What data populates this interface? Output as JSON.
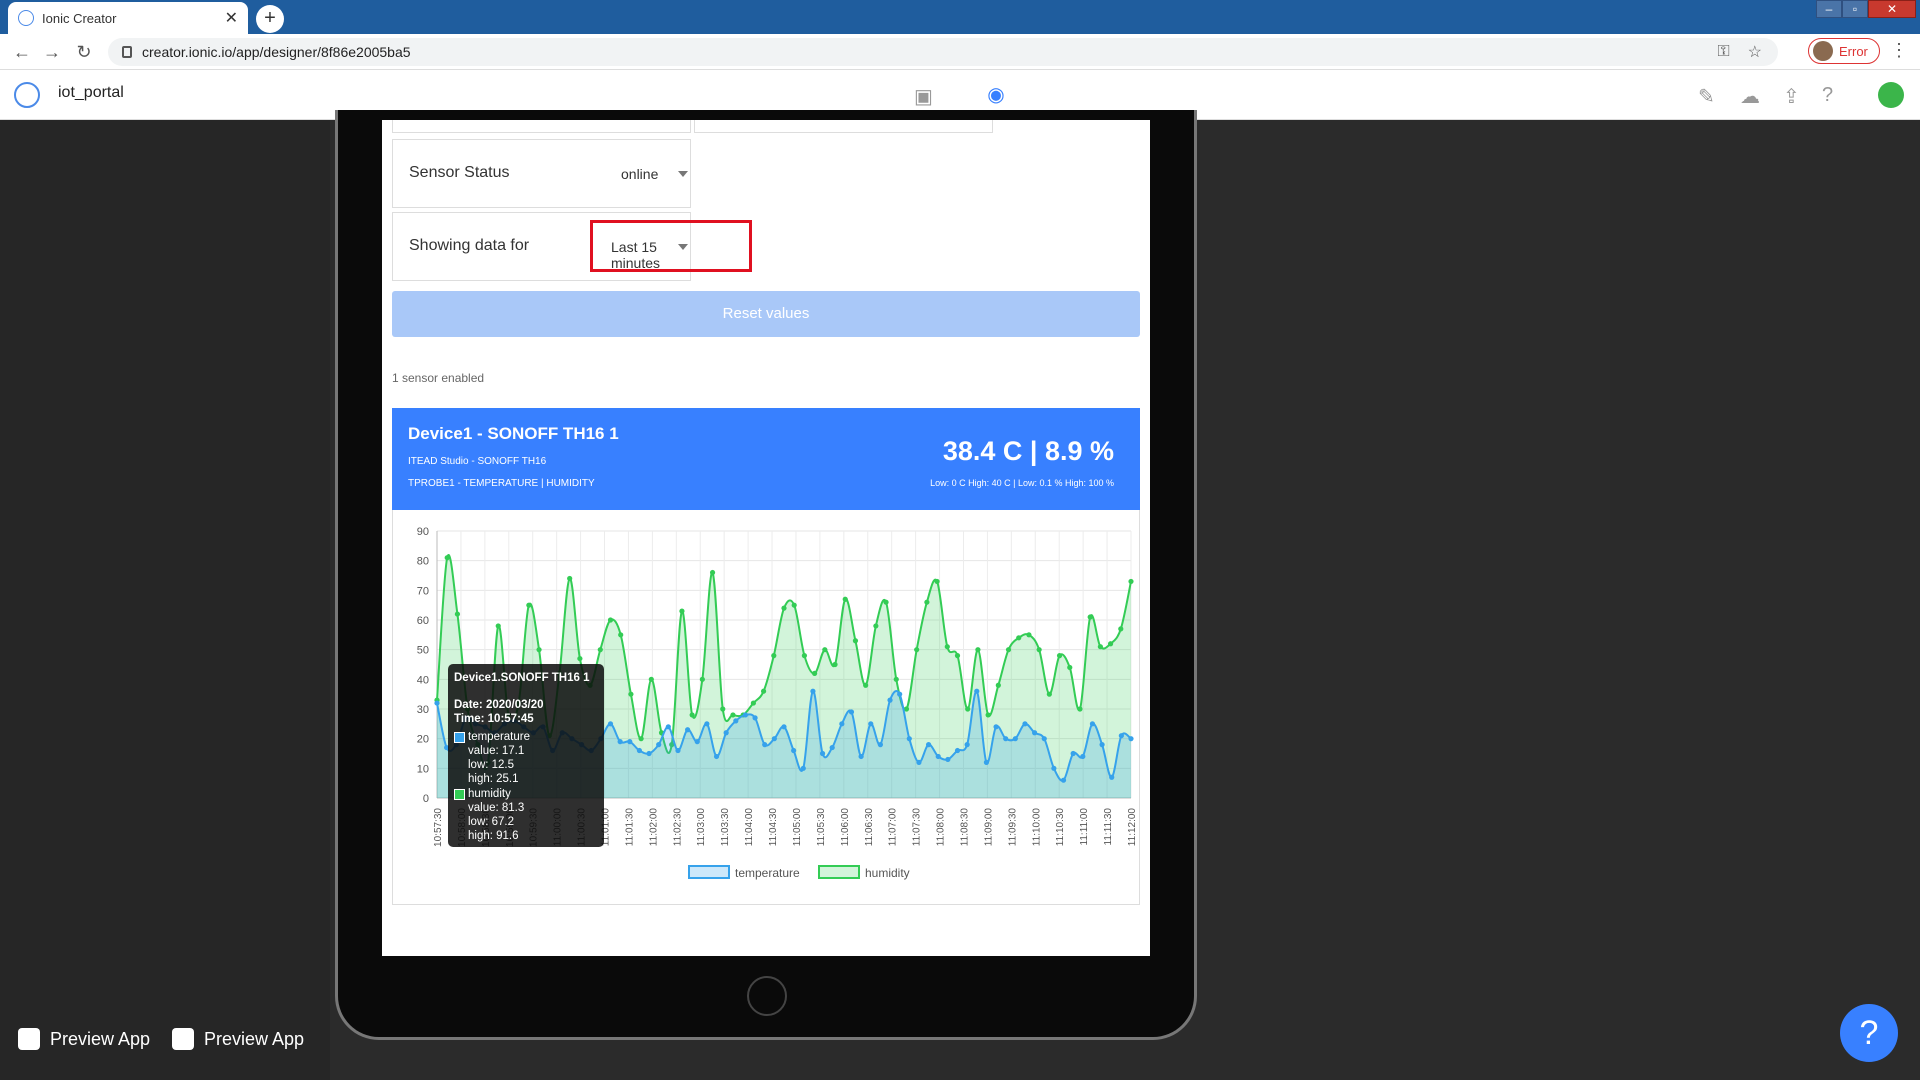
{
  "browser": {
    "tab_title": "Ionic Creator",
    "url": "creator.ionic.io/app/designer/8f86e2005ba5",
    "error_label": "Error"
  },
  "app": {
    "name": "iot_portal"
  },
  "icons": {
    "back": "arrow-left-icon",
    "forward": "arrow-right-icon",
    "reload": "reload-icon",
    "lock": "lock-icon",
    "key": "key-icon",
    "star": "star-icon",
    "menu": "kebab-menu-icon",
    "preview": "eye-icon",
    "design": "device-icon",
    "brush": "brush-icon",
    "download": "cloud-download-icon",
    "share": "share-icon",
    "help": "help-icon",
    "apple": "apple-icon",
    "android": "play-store-icon"
  },
  "colors": {
    "accent": "#3880ff",
    "temperature": "#36a2eb",
    "humidity": "#33cc55",
    "highlight": "#e01020"
  },
  "bottom": {
    "preview_ios": "Preview App",
    "preview_android": "Preview App",
    "help": "?"
  },
  "form": {
    "sensor_status_label": "Sensor Status",
    "sensor_status_value": "online",
    "showing_label": "Showing data for",
    "showing_value": "Last 15 minutes",
    "reset_label": "Reset values",
    "sensors_enabled": "1 sensor enabled"
  },
  "device": {
    "name": "Device1 - SONOFF TH16 1",
    "vendor": "ITEAD Studio - SONOFF TH16",
    "probe": "TPROBE1 - TEMPERATURE | HUMIDITY",
    "reading": "38.4 C | 8.9 %",
    "range": "Low: 0 C High: 40 C | Low: 0.1 % High: 100 %"
  },
  "tooltip": {
    "title": "Device1.SONOFF TH16 1",
    "date": "Date: 2020/03/20",
    "time": "Time: 10:57:45",
    "t_name": "temperature",
    "t_value": "value: 17.1",
    "t_low": "low: 12.5",
    "t_high": "high: 25.1",
    "h_name": "humidity",
    "h_value": "value: 81.3",
    "h_low": "low: 67.2",
    "h_high": "high: 91.6"
  },
  "chart_data": {
    "type": "area",
    "title": "",
    "xlabel": "",
    "ylabel": "",
    "ylim": [
      0,
      90
    ],
    "yticks": [
      0,
      10,
      20,
      30,
      40,
      50,
      60,
      70,
      80,
      90
    ],
    "grid": true,
    "legend": "bottom",
    "xticks": [
      "10:57:30",
      "10:58:00",
      "10:58:30",
      "10:59:00",
      "10:59:30",
      "11:00:00",
      "11:00:30",
      "11:01:00",
      "11:01:30",
      "11:02:00",
      "11:02:30",
      "11:03:00",
      "11:03:30",
      "11:04:00",
      "11:04:30",
      "11:05:00",
      "11:05:30",
      "11:06:00",
      "11:06:30",
      "11:07:00",
      "11:07:30",
      "11:08:00",
      "11:08:30",
      "11:09:00",
      "11:09:30",
      "11:10:00",
      "11:10:30",
      "11:11:00",
      "11:11:30",
      "11:12:00"
    ],
    "series": [
      {
        "name": "humidity",
        "color": "#33cc55",
        "values": [
          33,
          81,
          62,
          30,
          18,
          12,
          58,
          28,
          32,
          65,
          50,
          21,
          42,
          74,
          47,
          38,
          50,
          60,
          55,
          35,
          20,
          40,
          22,
          18,
          63,
          28,
          40,
          76,
          30,
          28,
          28,
          32,
          36,
          48,
          64,
          65,
          48,
          42,
          50,
          45,
          67,
          53,
          38,
          58,
          66,
          40,
          30,
          50,
          66,
          73,
          51,
          48,
          30,
          50,
          28,
          38,
          50,
          54,
          55,
          50,
          35,
          48,
          44,
          30,
          61,
          51,
          52,
          57,
          73
        ]
      },
      {
        "name": "temperature",
        "color": "#36a2eb",
        "values": [
          32,
          17,
          18,
          27,
          25,
          24,
          22,
          25,
          26,
          24,
          22,
          24,
          16,
          22,
          20,
          18,
          16,
          20,
          25,
          19,
          19,
          16,
          15,
          18,
          24,
          16,
          23,
          19,
          25,
          14,
          22,
          26,
          28,
          27,
          18,
          20,
          24,
          16,
          10,
          36,
          15,
          17,
          25,
          29,
          14,
          25,
          18,
          33,
          35,
          20,
          12,
          18,
          14,
          13,
          16,
          18,
          36,
          12,
          24,
          20,
          20,
          25,
          22,
          20,
          10,
          6,
          15,
          14,
          25,
          18,
          7,
          21,
          20
        ]
      }
    ]
  }
}
